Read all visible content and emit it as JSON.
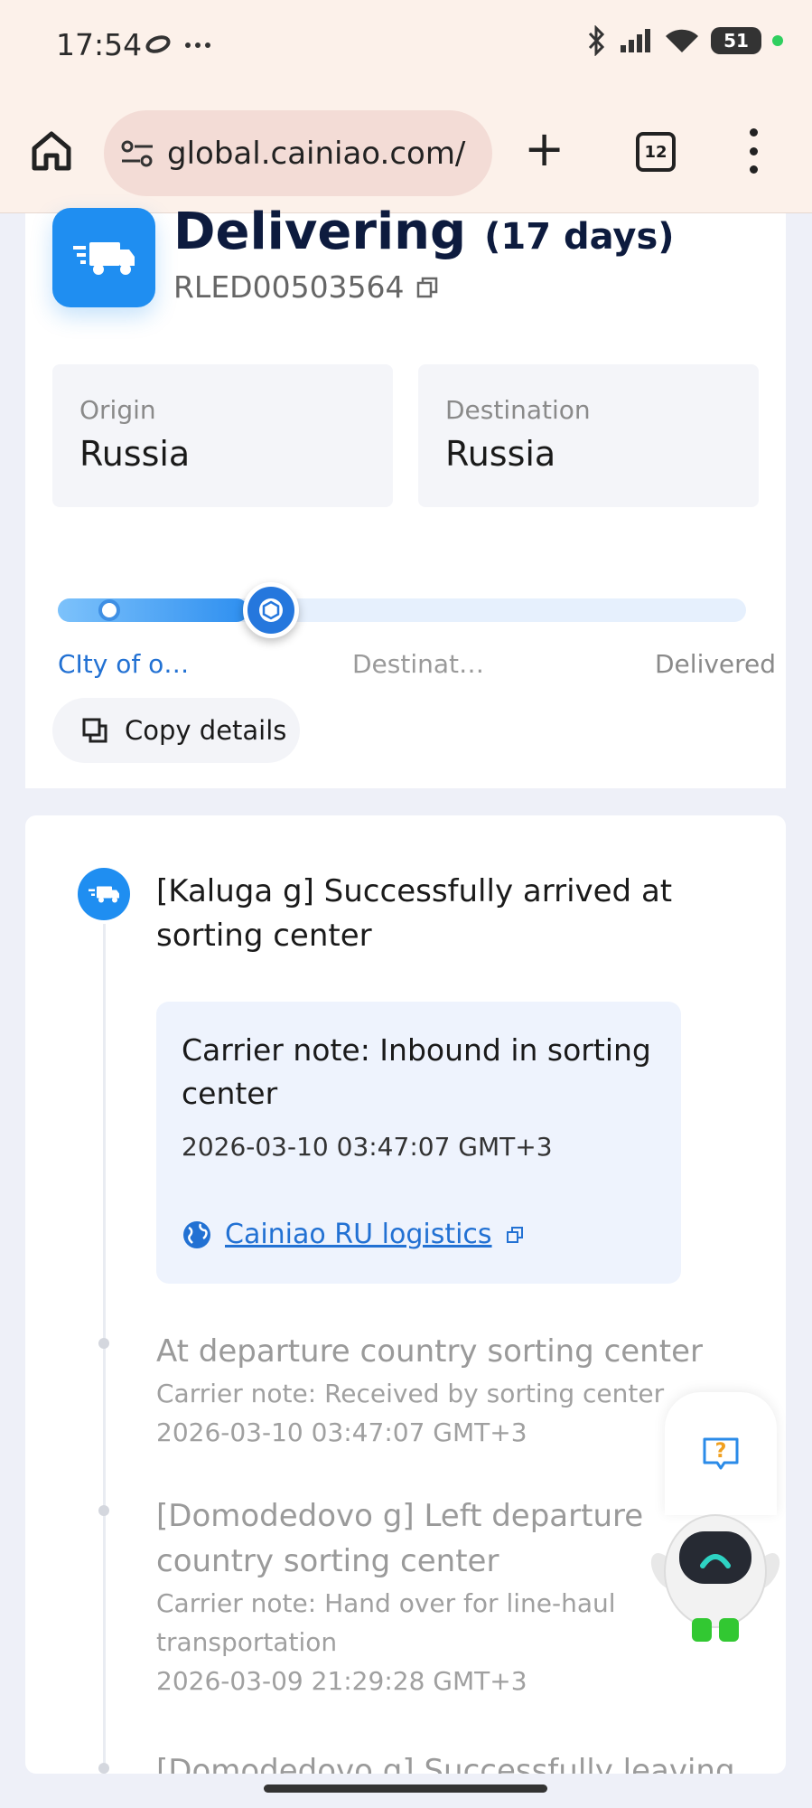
{
  "status_bar": {
    "time": "17:54",
    "battery": "51"
  },
  "browser": {
    "url": "global.cainiao.com/",
    "tab_count": "12"
  },
  "summary": {
    "status": "Delivering",
    "days": "(17 days)",
    "tracking_number": "RLED00503564",
    "origin_label": "Origin",
    "origin_value": "Russia",
    "destination_label": "Destination",
    "destination_value": "Russia",
    "progress_fraction": 0.25,
    "stages": [
      "CIty of o…",
      "Destinat…",
      "Delivered"
    ],
    "copy_label": "Copy details"
  },
  "timeline": {
    "current": {
      "title": "[Kaluga g] Successfully arrived at sorting center",
      "note": "Carrier note: Inbound in sorting center",
      "time": "2026-03-10 03:47:07 GMT+3",
      "carrier": "Cainiao RU logistics"
    },
    "events": [
      {
        "title": "At departure country sorting center",
        "note": "Carrier note: Received by sorting center",
        "time": "2026-03-10 03:47:07 GMT+3"
      },
      {
        "title": "[Domodedovo g] Left departure country sorting center",
        "note": "Carrier note: Hand over for line-haul transportation",
        "time": "2026-03-09 21:29:28 GMT+3"
      },
      {
        "title": "[Domodedovo g] Successfully leaving",
        "note": "",
        "time": ""
      }
    ]
  },
  "colors": {
    "accent": "#1f8ef1",
    "link": "#2271d3"
  }
}
